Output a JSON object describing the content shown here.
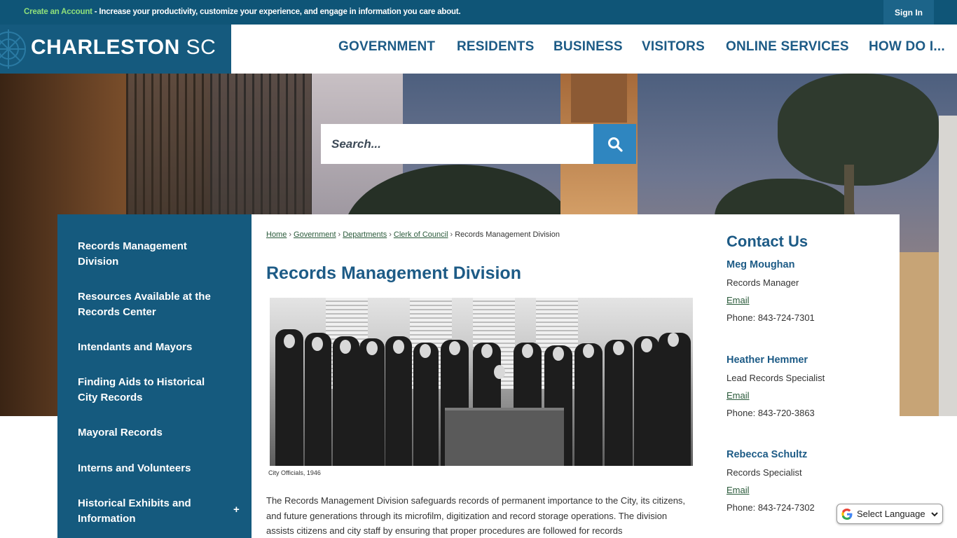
{
  "topbar": {
    "create_account": "Create an Account",
    "message": " - Increase your productivity, customize your experience, and engage in information you care about.",
    "sign_in": "Sign In"
  },
  "header": {
    "brand_main": "CHARLESTON",
    "brand_suffix": "SC",
    "nav": [
      "GOVERNMENT",
      "RESIDENTS",
      "BUSINESS",
      "VISITORS",
      "ONLINE SERVICES",
      "HOW DO I..."
    ]
  },
  "search": {
    "placeholder": "Search..."
  },
  "sidebar": {
    "items": [
      "Records Management Division",
      "Resources Available at the Records Center",
      "Intendants and Mayors",
      "Finding Aids to Historical City Records",
      "Mayoral Records",
      "Interns and Volunteers",
      "Historical Exhibits and Information"
    ],
    "expand_symbol": "+"
  },
  "breadcrumb": {
    "links": [
      "Home",
      "Government",
      "Departments",
      "Clerk of Council"
    ],
    "current": "Records Management Division"
  },
  "main": {
    "title": "Records Management Division",
    "photo_caption": "City Officials, 1946",
    "body": "The Records Management Division safeguards records of permanent importance to the City, its citizens, and future generations through its microfilm, digitization and record storage operations. The division assists citizens and city staff by ensuring that proper procedures are followed for records"
  },
  "contact": {
    "title": "Contact Us",
    "people": [
      {
        "name": "Meg Moughan",
        "role": "Records Manager",
        "email": "Email",
        "phone": "Phone: 843-724-7301"
      },
      {
        "name": "Heather Hemmer",
        "role": "Lead Records Specialist",
        "email": "Email",
        "phone": "Phone: 843-720-3863"
      },
      {
        "name": "Rebecca Schultz",
        "role": "Records Specialist",
        "email": "Email",
        "phone": "Phone: 843-724-7302"
      }
    ]
  },
  "translate": {
    "label": "Select Language"
  },
  "colors": {
    "primary": "#155a7e",
    "topbar": "#0f5577",
    "accent": "#2f86c0",
    "link": "#2a5a3a",
    "create_account": "#8fe07a"
  }
}
